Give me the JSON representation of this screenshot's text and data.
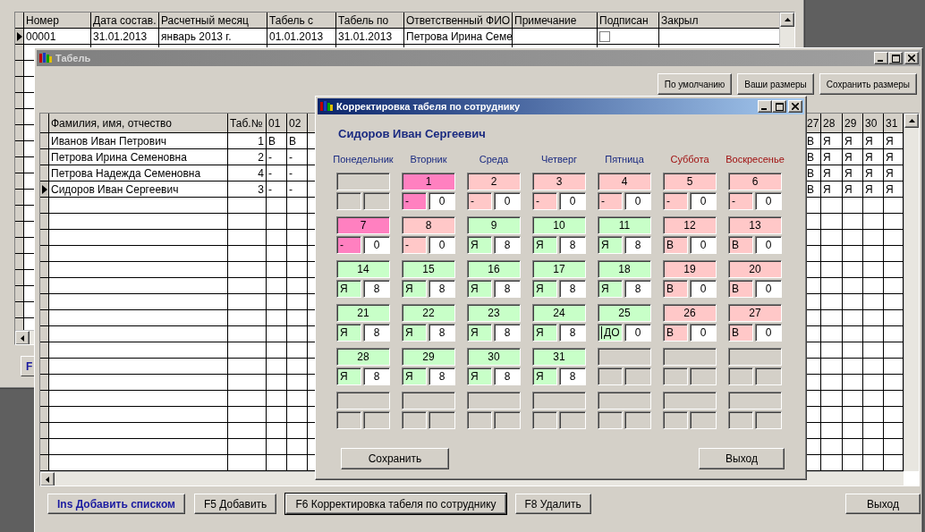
{
  "background_window": {
    "partial_button": "F",
    "grid": {
      "columns": [
        "Номер",
        "Дата состав.",
        "Расчетный месяц",
        "Табель с",
        "Табель по",
        "Ответственный ФИО",
        "Примечание",
        "Подписан",
        "Закрыл"
      ],
      "rows": [
        {
          "number": "00001",
          "date": "31.01.2013",
          "month": "январь 2013 г.",
          "from": "01.01.2013",
          "to": "31.01.2013",
          "responsible": "Петрова Ирина Семе",
          "signed": false,
          "selected": true
        }
      ]
    }
  },
  "tabel_window": {
    "title": "Табель",
    "toolbar": [
      "По умолчанию",
      "Ваши размеры",
      "Сохранить размеры"
    ],
    "table": {
      "left_columns": [
        "Фамилия, имя, отчество",
        "Таб.№",
        "01",
        "02"
      ],
      "right_columns": [
        "27",
        "28",
        "29",
        "30",
        "31"
      ],
      "rows": [
        {
          "name": "Иванов Иван Петрович",
          "number": "1",
          "left_days": [
            "В",
            "В"
          ],
          "right_days": [
            "В",
            "Я",
            "Я",
            "Я",
            "Я"
          ],
          "selected": false
        },
        {
          "name": "Петрова Ирина Семеновна",
          "number": "2",
          "left_days": [
            "-",
            "-"
          ],
          "right_days": [
            "В",
            "Я",
            "Я",
            "Я",
            "Я"
          ],
          "selected": false
        },
        {
          "name": "Петрова Надежда Семеновна",
          "number": "4",
          "left_days": [
            "-",
            "-"
          ],
          "right_days": [
            "В",
            "Я",
            "Я",
            "Я",
            "Я"
          ],
          "selected": false
        },
        {
          "name": "Сидоров Иван Сергеевич",
          "number": "3",
          "left_days": [
            "-",
            "-"
          ],
          "right_days": [
            "В",
            "Я",
            "Я",
            "Я",
            "Я"
          ],
          "selected": true
        }
      ]
    },
    "buttons": [
      {
        "label": "Ins Добавить списком",
        "kind": "primary"
      },
      {
        "label": "F5 Добавить",
        "kind": "normal"
      },
      {
        "label": "F6 Корректировка табеля по сотруднику",
        "kind": "focused"
      },
      {
        "label": "F8 Удалить",
        "kind": "normal"
      },
      {
        "label": "Выход",
        "kind": "exit"
      }
    ]
  },
  "dialog": {
    "title": "Корректировка табеля по сотруднику",
    "employee": "Сидоров Иван Сергеевич",
    "weekdays": [
      {
        "label": "Понедельник",
        "weekend": false
      },
      {
        "label": "Вторник",
        "weekend": false
      },
      {
        "label": "Среда",
        "weekend": false
      },
      {
        "label": "Четверг",
        "weekend": false
      },
      {
        "label": "Пятница",
        "weekend": false
      },
      {
        "label": "Суббота",
        "weekend": true
      },
      {
        "label": "Воскресенье",
        "weekend": true
      }
    ],
    "weeks": [
      [
        {
          "kind": "empty"
        },
        {
          "day": "1",
          "code": "-",
          "hours": "0",
          "kind": "marked",
          "focused": false
        },
        {
          "day": "2",
          "code": "-",
          "hours": "0",
          "kind": "off",
          "focused": false
        },
        {
          "day": "3",
          "code": "-",
          "hours": "0",
          "kind": "off",
          "focused": false
        },
        {
          "day": "4",
          "code": "-",
          "hours": "0",
          "kind": "off",
          "focused": false
        },
        {
          "day": "5",
          "code": "-",
          "hours": "0",
          "kind": "off",
          "focused": false
        },
        {
          "day": "6",
          "code": "-",
          "hours": "0",
          "kind": "off",
          "focused": false
        }
      ],
      [
        {
          "day": "7",
          "code": "-",
          "hours": "0",
          "kind": "marked",
          "focused": false
        },
        {
          "day": "8",
          "code": "-",
          "hours": "0",
          "kind": "off",
          "focused": false
        },
        {
          "day": "9",
          "code": "Я",
          "hours": "8",
          "kind": "work",
          "focused": false
        },
        {
          "day": "10",
          "code": "Я",
          "hours": "8",
          "kind": "work",
          "focused": false
        },
        {
          "day": "11",
          "code": "Я",
          "hours": "8",
          "kind": "work",
          "focused": false
        },
        {
          "day": "12",
          "code": "В",
          "hours": "0",
          "kind": "off",
          "focused": false
        },
        {
          "day": "13",
          "code": "В",
          "hours": "0",
          "kind": "off",
          "focused": false
        }
      ],
      [
        {
          "day": "14",
          "code": "Я",
          "hours": "8",
          "kind": "work",
          "focused": false
        },
        {
          "day": "15",
          "code": "Я",
          "hours": "8",
          "kind": "work",
          "focused": false
        },
        {
          "day": "16",
          "code": "Я",
          "hours": "8",
          "kind": "work",
          "focused": false
        },
        {
          "day": "17",
          "code": "Я",
          "hours": "8",
          "kind": "work",
          "focused": false
        },
        {
          "day": "18",
          "code": "Я",
          "hours": "8",
          "kind": "work",
          "focused": false
        },
        {
          "day": "19",
          "code": "В",
          "hours": "0",
          "kind": "off",
          "focused": false
        },
        {
          "day": "20",
          "code": "В",
          "hours": "0",
          "kind": "off",
          "focused": false
        }
      ],
      [
        {
          "day": "21",
          "code": "Я",
          "hours": "8",
          "kind": "work",
          "focused": false
        },
        {
          "day": "22",
          "code": "Я",
          "hours": "8",
          "kind": "work",
          "focused": false
        },
        {
          "day": "23",
          "code": "Я",
          "hours": "8",
          "kind": "work",
          "focused": false
        },
        {
          "day": "24",
          "code": "Я",
          "hours": "8",
          "kind": "work",
          "focused": false
        },
        {
          "day": "25",
          "code": "ДО",
          "hours": "0",
          "kind": "work",
          "focused": true
        },
        {
          "day": "26",
          "code": "В",
          "hours": "0",
          "kind": "off",
          "focused": false
        },
        {
          "day": "27",
          "code": "В",
          "hours": "0",
          "kind": "off",
          "focused": false
        }
      ],
      [
        {
          "day": "28",
          "code": "Я",
          "hours": "8",
          "kind": "work",
          "focused": false
        },
        {
          "day": "29",
          "code": "Я",
          "hours": "8",
          "kind": "work",
          "focused": false
        },
        {
          "day": "30",
          "code": "Я",
          "hours": "8",
          "kind": "work",
          "focused": false
        },
        {
          "day": "31",
          "code": "Я",
          "hours": "8",
          "kind": "work",
          "focused": false
        },
        {
          "kind": "empty"
        },
        {
          "kind": "empty"
        },
        {
          "kind": "empty"
        }
      ],
      [
        {
          "kind": "empty"
        },
        {
          "kind": "empty"
        },
        {
          "kind": "empty"
        },
        {
          "kind": "empty"
        },
        {
          "kind": "empty"
        },
        {
          "kind": "empty"
        },
        {
          "kind": "empty"
        }
      ]
    ],
    "buttons": [
      "Сохранить",
      "Выход"
    ]
  }
}
